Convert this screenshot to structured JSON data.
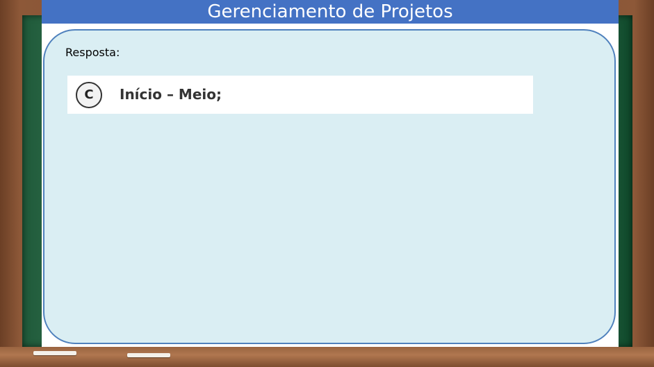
{
  "slide": {
    "title": "Gerenciamento de Projetos",
    "answer_label": "Resposta:",
    "option": {
      "letter": "C",
      "text": "Início – Meio;"
    }
  },
  "colors": {
    "title_bar": "#4472c4",
    "panel_fill": "#daeef3",
    "panel_border": "#4f81bd",
    "chalkboard": "#2a6244",
    "frame": "#7a4a2e"
  }
}
